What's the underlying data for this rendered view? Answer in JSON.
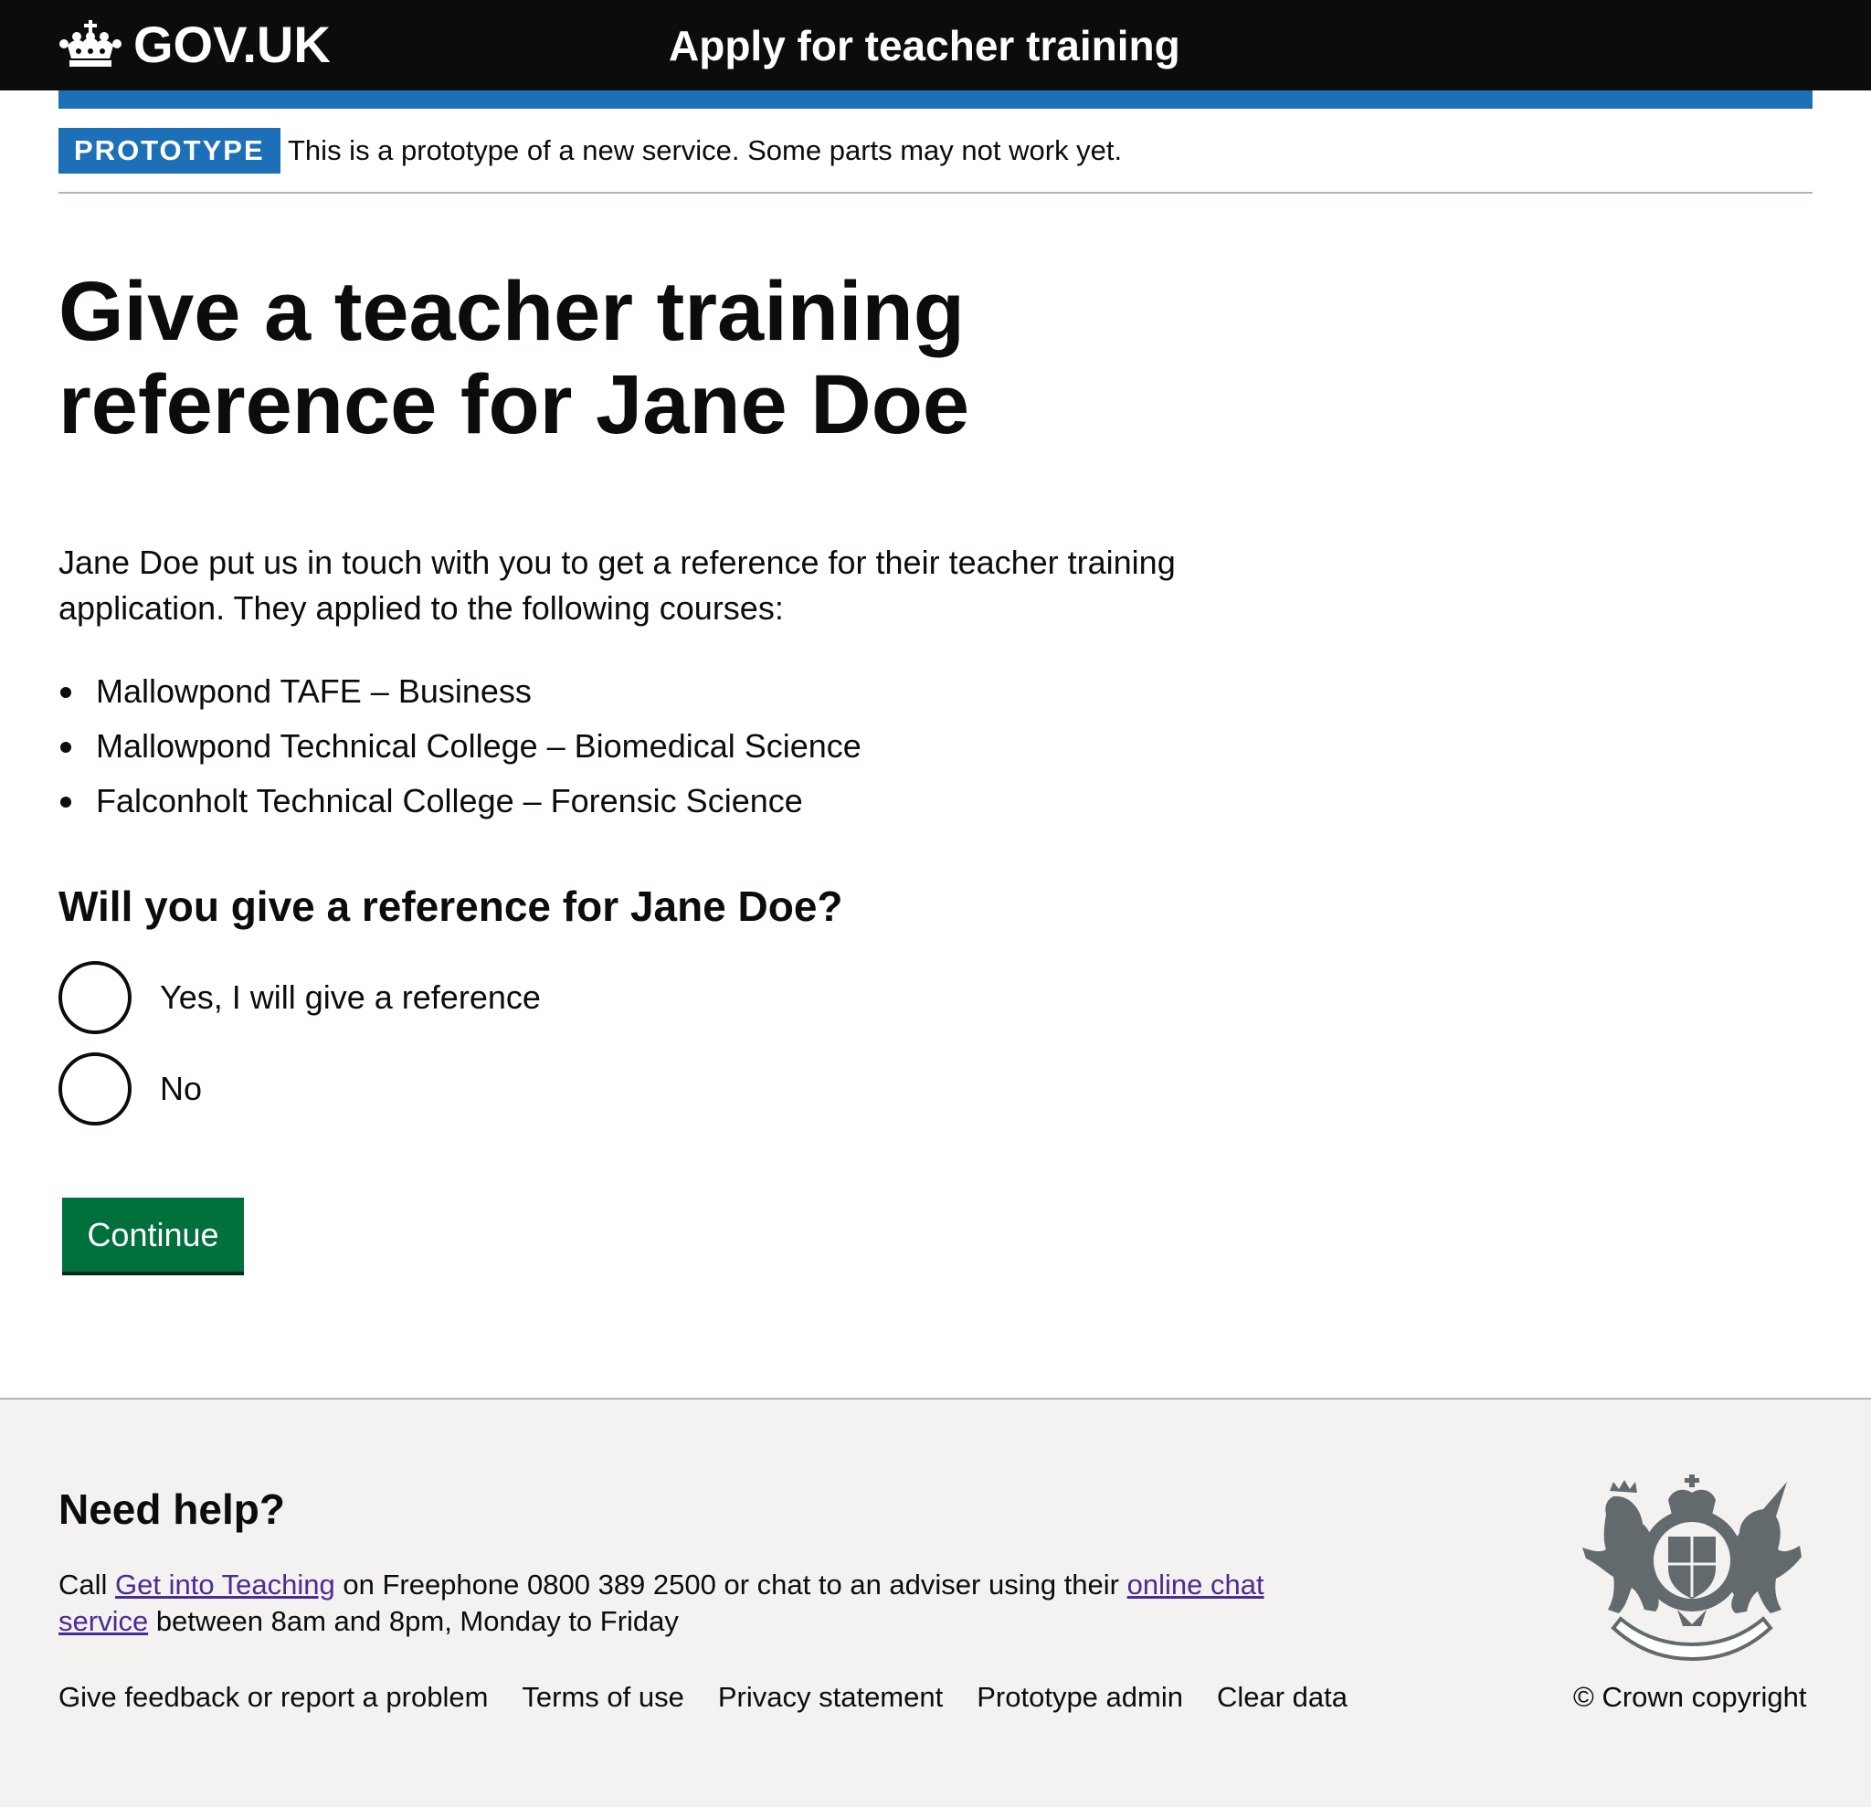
{
  "header": {
    "logo_text": "GOV.UK",
    "service_name": "Apply for teacher training"
  },
  "phase_banner": {
    "tag": "PROTOTYPE",
    "text": "This is a prototype of a new service. Some parts may not work yet."
  },
  "main": {
    "title_line1": "Give a teacher training",
    "title_line2": "reference for Jane Doe",
    "intro": "Jane Doe put us in touch with you to get a reference for their teacher training application. They applied to the following courses:",
    "courses": [
      "Mallowpond TAFE – Business",
      "Mallowpond Technical College – Biomedical Science",
      "Falconholt Technical College – Forensic Science"
    ],
    "question": "Will you give a reference for Jane Doe?",
    "options": [
      {
        "label": "Yes, I will give a reference",
        "selected": false
      },
      {
        "label": "No",
        "selected": false
      }
    ],
    "continue_label": "Continue"
  },
  "footer": {
    "heading": "Need help?",
    "help_prefix": "Call ",
    "help_link1": "Get into Teaching",
    "help_middle": " on Freephone 0800 389 2500 or chat to an adviser using their ",
    "help_link2": "online chat service",
    "help_suffix": " between 8am and 8pm, Monday to Friday",
    "links": [
      "Give feedback or report a problem",
      "Terms of use",
      "Privacy statement",
      "Prototype admin",
      "Clear data"
    ],
    "copyright": "© Crown copyright"
  },
  "colors": {
    "header_bg": "#0b0c0c",
    "brand_blue": "#1d70b8",
    "button_green": "#00703c",
    "link_visited": "#4c2c92",
    "footer_bg": "#f3f2f1"
  },
  "icons": [
    "crown-icon",
    "royal-coat-of-arms-icon"
  ]
}
